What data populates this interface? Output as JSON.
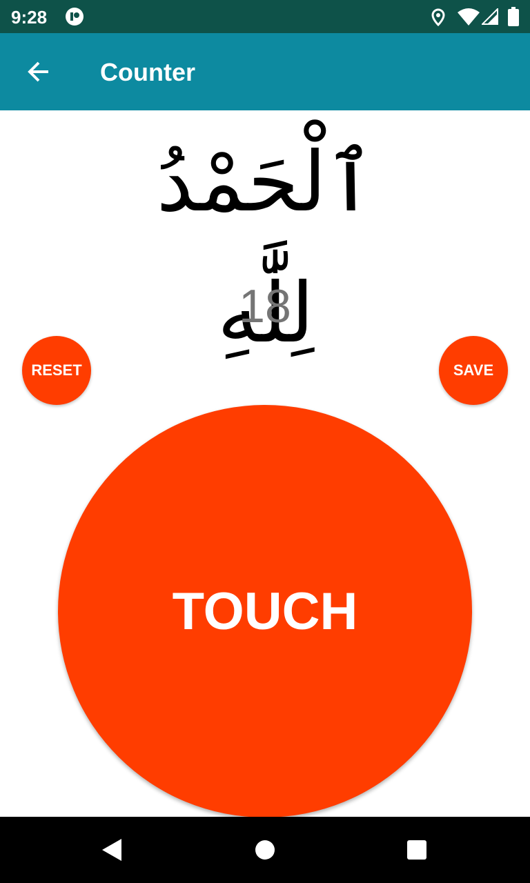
{
  "status_bar": {
    "time": "9:28"
  },
  "app_bar": {
    "title": "Counter",
    "back_icon": "arrow-left-icon"
  },
  "dhikr": {
    "text": "ٱلْحَمْدُ لِلَّٰهِ"
  },
  "counter": {
    "value": "18"
  },
  "buttons": {
    "reset": "RESET",
    "save": "SAVE",
    "touch": "TOUCH"
  },
  "colors": {
    "status": "#0e5249",
    "appbar": "#0d8aa0",
    "accent": "#ff3d00"
  }
}
